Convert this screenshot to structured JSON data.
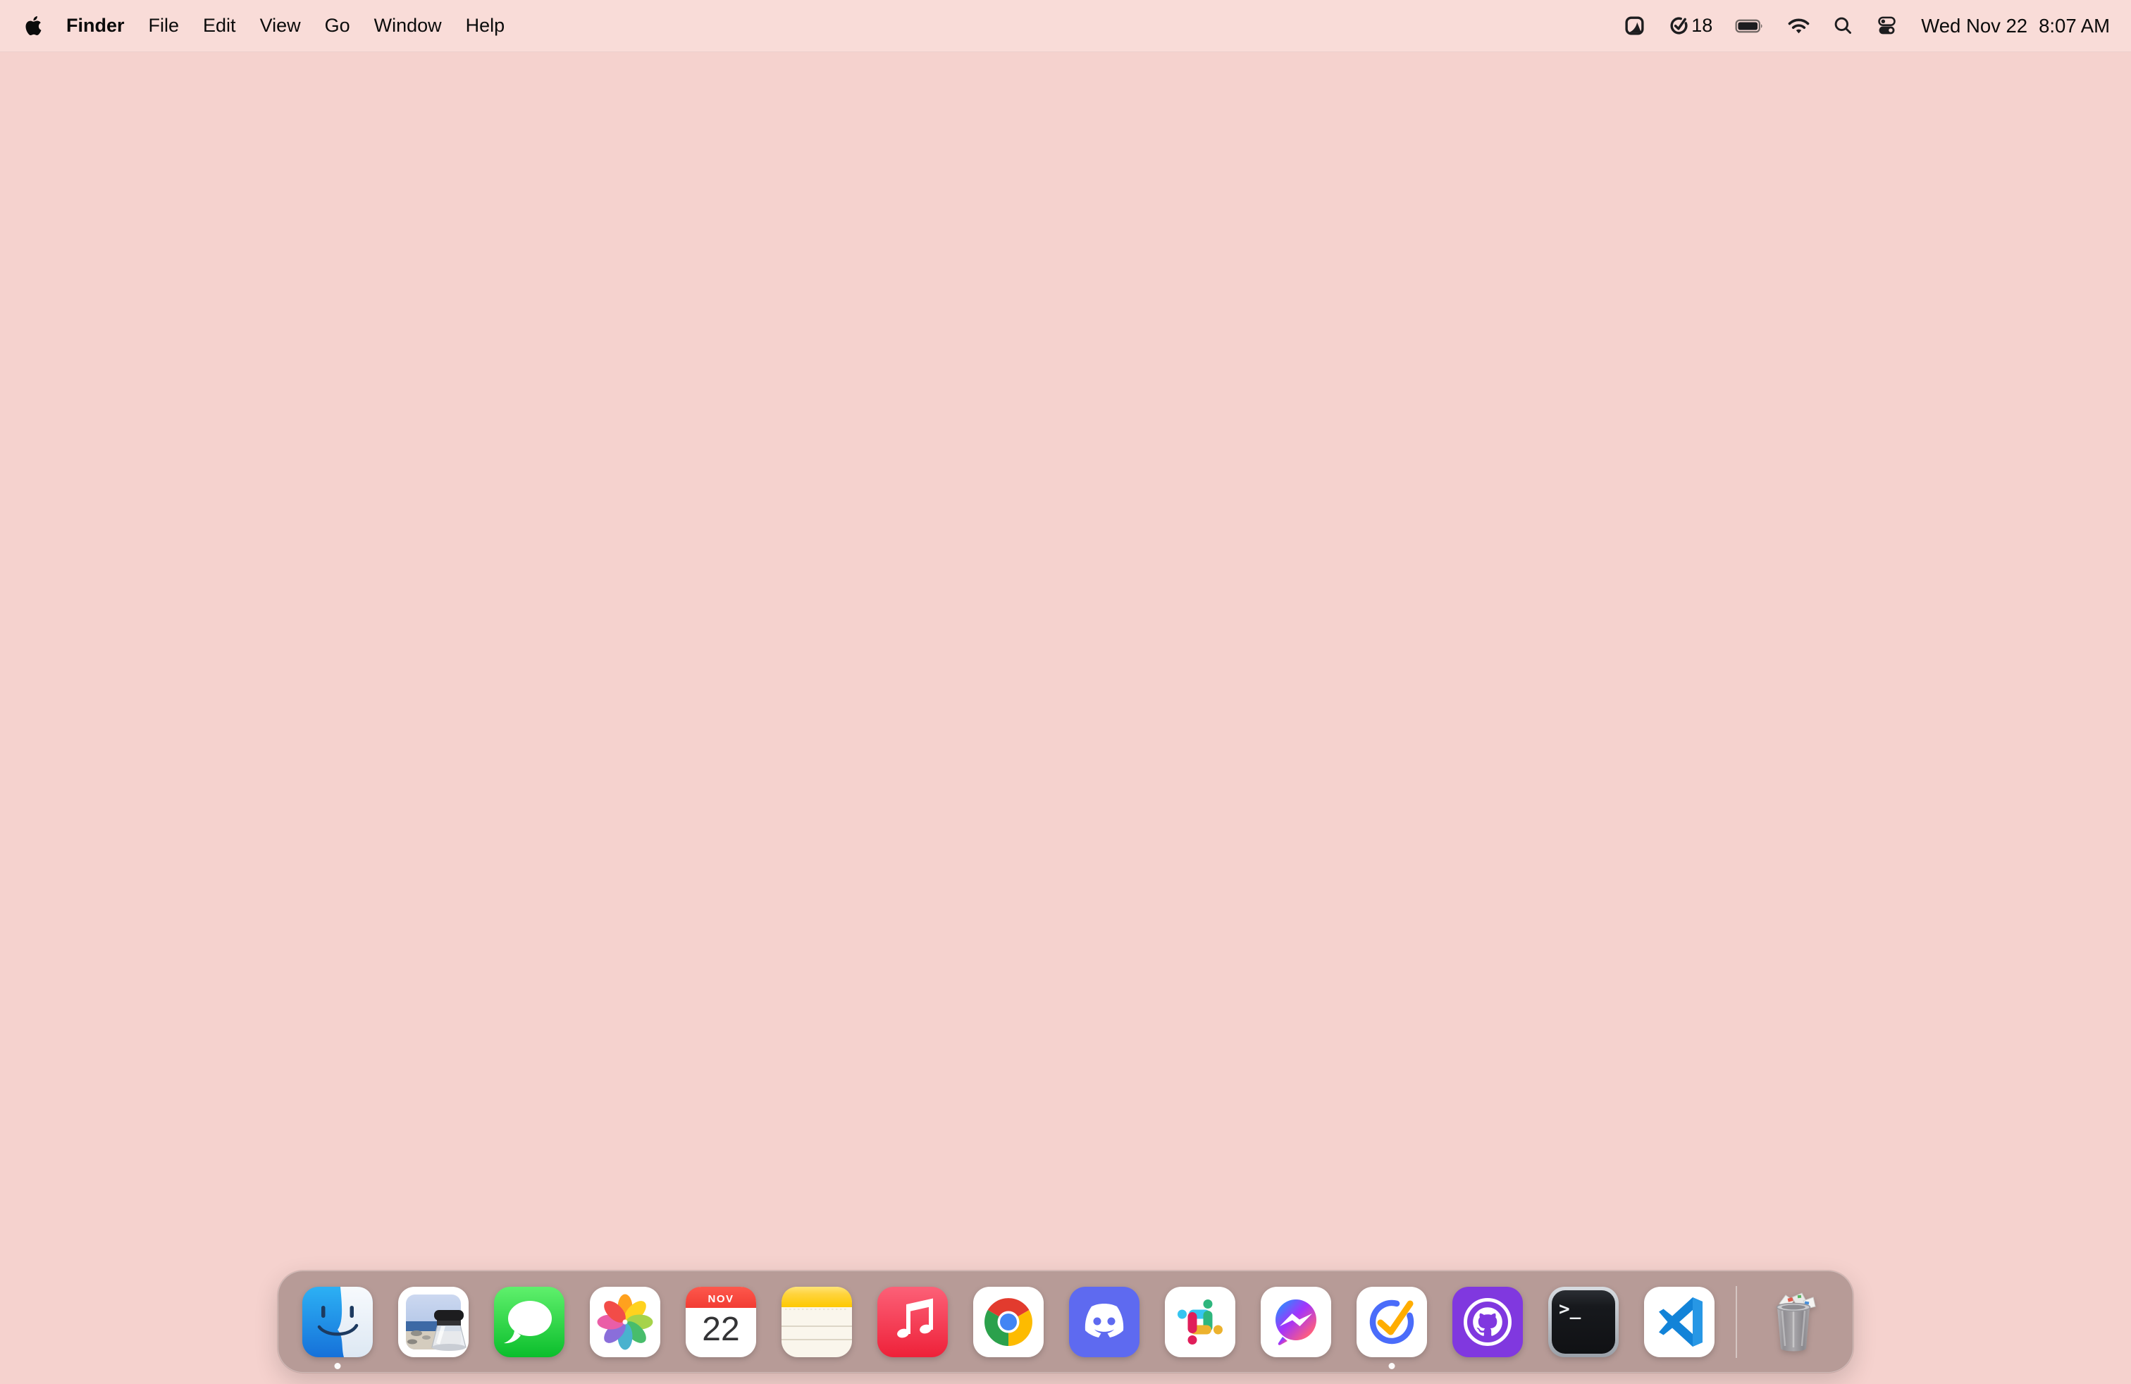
{
  "wallpaper_color": "#f5d2ce",
  "menu_bar": {
    "app_menu_label": "Finder",
    "menus": [
      "File",
      "Edit",
      "View",
      "Go",
      "Window",
      "Help"
    ],
    "status": {
      "task_count": "18",
      "date": "Wed Nov 22",
      "time": "8:07 AM"
    }
  },
  "dock": {
    "tint_color": "#b69b97",
    "calendar_icon": {
      "month": "NOV",
      "day": "22"
    },
    "terminal_icon": {
      "glyph": ">_"
    },
    "apps": [
      {
        "name": "Finder",
        "active": true
      },
      {
        "name": "Preview",
        "active": false
      },
      {
        "name": "Messages",
        "active": false
      },
      {
        "name": "Photos",
        "active": false
      },
      {
        "name": "Calendar",
        "active": false
      },
      {
        "name": "Notes",
        "active": false
      },
      {
        "name": "Music",
        "active": false
      },
      {
        "name": "Google Chrome",
        "active": false
      },
      {
        "name": "Discord",
        "active": false
      },
      {
        "name": "Slack",
        "active": false
      },
      {
        "name": "Messenger",
        "active": false
      },
      {
        "name": "TickTick",
        "active": true
      },
      {
        "name": "GitHub Desktop",
        "active": false
      },
      {
        "name": "Terminal",
        "active": false
      },
      {
        "name": "Visual Studio Code",
        "active": false
      },
      {
        "name": "Trash",
        "active": false
      }
    ]
  }
}
